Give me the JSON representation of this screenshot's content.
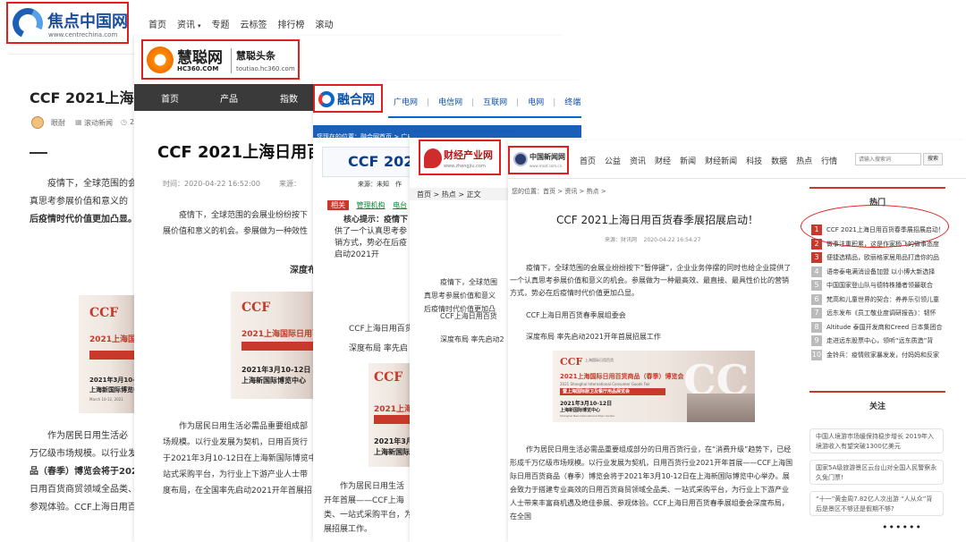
{
  "w1": {
    "logo_main": "焦点中国网",
    "logo_url": "www.centrechina.com",
    "nav": [
      "首页",
      "资讯",
      "专题",
      "云标签",
      "排行榜",
      "滚动"
    ],
    "title": "CCF 2021上海",
    "author": "眼耐",
    "category": "滚动新闻",
    "time_frag": "2",
    "p1a": "疫情下，全球范围的会",
    "p1b": "真思考参展价值和意义的",
    "p1c": "后疫情时代价值更加凸显。",
    "p2a": "作为居民日用生活必",
    "p2b": "万亿级市场规模。以行业发",
    "p2c": "品（春季）博览会将于202",
    "p2d": "日用百货商贸领域全品类、",
    "p2e": "参观体验。CCF上海日用百货春季展组委会深度布局，在全国率先启动20"
  },
  "w2": {
    "logo_main": "慧聪网",
    "logo_sub": "HC360.COM",
    "logo_name": "慧聪头条",
    "logo_url": "toutiao.hc360.com",
    "nav": [
      "首页",
      "产品",
      "指数"
    ],
    "title": "CCF 2021上海日用百",
    "time": "时间：2020-04-22 16:52:00",
    "source": "来源：",
    "p1a": "疫情下，全球范围的会展业纷纷按下",
    "p1b": "展价值和意义的机会。参展做为一种效性",
    "deep": "深度布",
    "p2a": "作为居民日用生活必需品重要组成部",
    "p2b": "场规模。以行业发展为契机，日用百货行",
    "p2c": "于2021年3月10-12日在上海新国际博览中",
    "p2d": "站式采购平台，为行业上下游产业人士带",
    "p2e": "度布局，在全国率先启动2021开年首展招"
  },
  "w3": {
    "logo": "融合网",
    "nav": [
      "广电网",
      "电信网",
      "互联网",
      "电网",
      "终端"
    ],
    "crumb": "您现在的位置：融合网首页 > 广电 > 其他 >",
    "title": "CCF 202",
    "src": "来源：未知",
    "auth": "作",
    "tags": [
      "相关",
      "管理机构",
      "电台"
    ],
    "tip_a": "核心提示：疫情下",
    "tip_b": "供了一个认真思考参",
    "tip_c": "销方式，势必在后疫",
    "tip_d": "启动2021开",
    "l1": "CCF上海日用百货",
    "l2": "深度布局 率先启",
    "p_a": "作为居民日用生活",
    "p_b": "开年首展——CCF上海",
    "p_c": "类、一站式采购平台，为",
    "p_d": "展招展工作。"
  },
  "w4": {
    "logo": "财经产业网",
    "logo_url": "www.zhengjiu.com",
    "crumb": "首页 > 热点 > 正文",
    "a": "疫情下，全球范围",
    "b": "真思考参展价值和意义",
    "c": "后疫情时代价值更加凸",
    "d": "CCF上海日用百货",
    "e": "深度布局 率先启动2"
  },
  "w5": {
    "logo": "中国新闻网",
    "logo_url": "www.mezf.com.cn",
    "nav": [
      "首页",
      "公益",
      "资讯",
      "财经",
      "新闻",
      "财经新闻",
      "科技",
      "数据",
      "热点",
      "行情"
    ],
    "search_placeholder": "请输入搜索词",
    "search_btn": "搜索",
    "crumb": "您的位置：首页 > 资讯 > 热点 >",
    "title": "CCF 2021上海日用百货春季展招展启动！",
    "meta": "来源：财讯网",
    "date": "2020-04-22 16:54:27",
    "p1": "疫情下，全球范围的会展业纷纷按下“暂停键”，企业业务停摆的同时也给企业提供了一个认真思考参展价值和意义的机会。参展做为一种最高效、最直接、最具性价比的营销方式，势必在后疫情时代价值更加凸显。",
    "l1": "CCF上海日用百货春季展组委会",
    "l2": "深度布局 率先启动2021开年首展招展工作",
    "p2": "作为居民日用生活必需品重要组成部分的日用百货行业，在“消费升级”趋势下，已经形成千万亿级市场规模。以行业发展为契机，日用百货行业2021开年首展——CCF上海国际日用百货商品（春季）博览会将于2021年3月10-12日在上海新国际博览中心举办。展会致力于搭建专业高效的日用百货商贸领域全品类、一站式采购平台，为行业上下游产业人士带来丰富商机遇及绝佳参展、参观体验。CCF上海日用百货春季展组委会深度布局，在全国",
    "hot_title": "热门",
    "hot": [
      "CCF 2021上海日用百货春季展招展启动！",
      "做事注重积累，这是作家杨飞的做事态度",
      "便捷选精品，欧丽格家居用品打造你的品",
      "语帝泰电满消设备加盟 以小博大新选择",
      "中国国家登山队与德特株播者领最联合",
      "梵高和儿童世界的契合：养养乐引领儿童",
      "远东发布《员工敬业度调研报告》：韧怀",
      "Altitude 泰国开发商和Creed 日本集团合",
      "走进远东股票中心，领听“远东质造”背",
      "金铃兵：疫情败家暴发发，付妈妈和反家"
    ],
    "follow_title": "关注",
    "follow": [
      "中国人境游市场缓保持稳步增长 2019年入境游收入有望突破1300亿美元",
      "国家5A级旅游景区云台山对全国人民警察永久免门票!",
      "“十一”黄金周7.82亿人次出游 “人从众”背后是景区不够还是假期不够?"
    ],
    "dots": "••••••"
  },
  "poster": {
    "brand": "CCF",
    "brand_sub": "上海国际日用百货",
    "y": "2021上海国际日用百货商品（春季）博览会",
    "en": "2021 Shanghai International Consumer Goods Fair",
    "sub": "暨上海国际厨卫及餐厅用品展览会",
    "date": "2021年3月10-12日",
    "venue": "上海新国际博览中心",
    "en_date": "March 10-12, 2021",
    "en_venue": "Shanghai New International Expo Center",
    "big": "CC"
  }
}
